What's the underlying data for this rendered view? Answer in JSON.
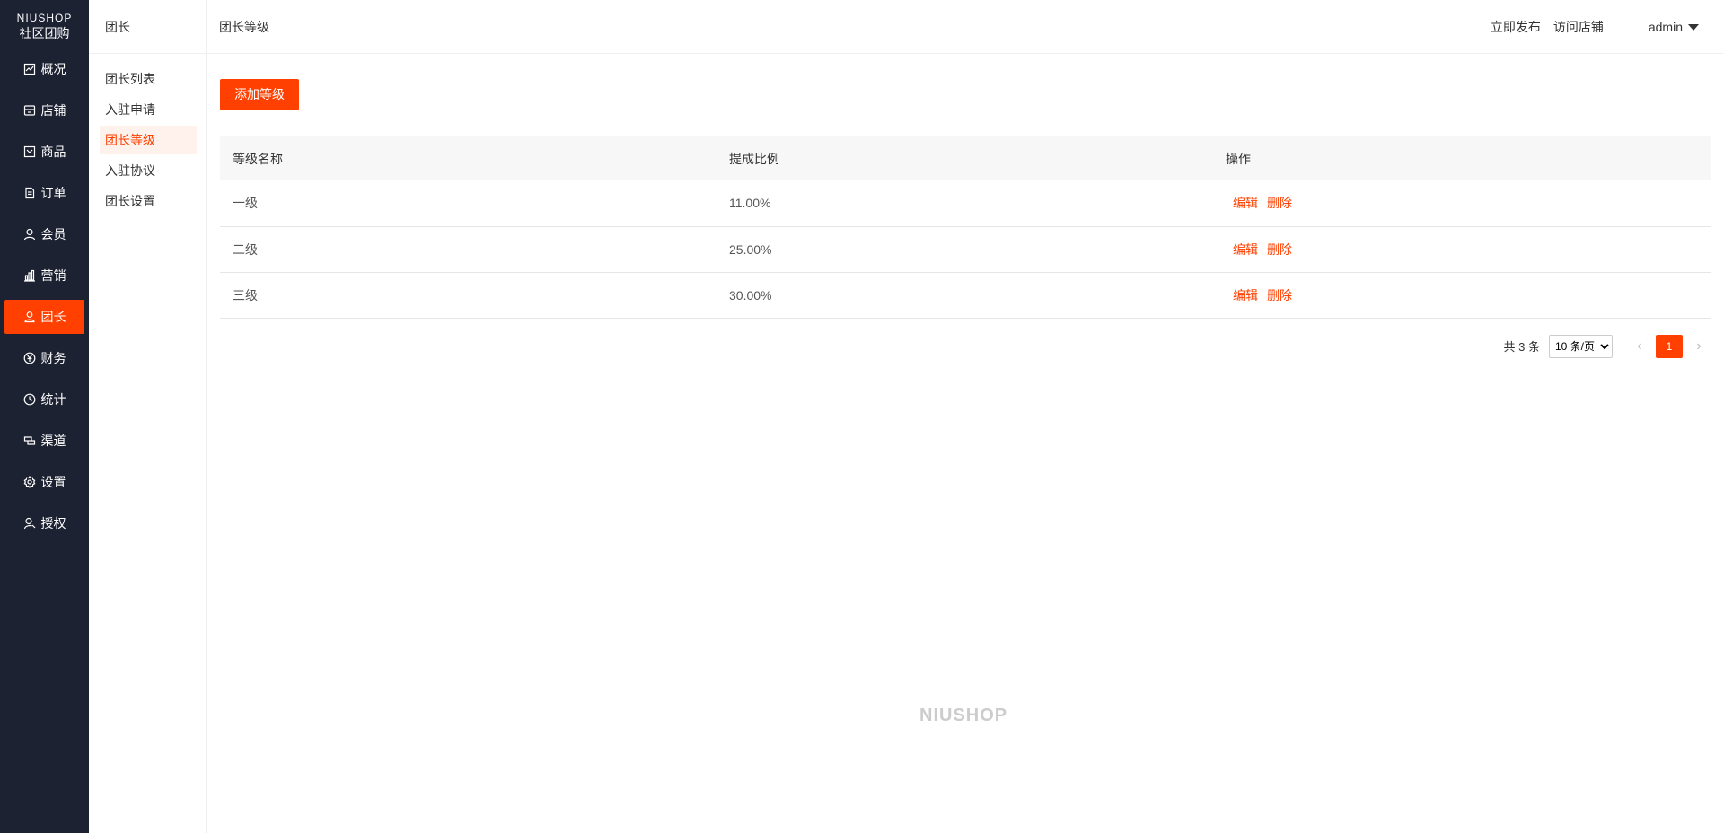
{
  "nav": {
    "brand": "NIUSHOP",
    "subtitle": "社区团购",
    "items": [
      {
        "label": "概况",
        "icon": "chart-line-icon"
      },
      {
        "label": "店铺",
        "icon": "shop-icon"
      },
      {
        "label": "商品",
        "icon": "goods-icon"
      },
      {
        "label": "订单",
        "icon": "order-icon"
      },
      {
        "label": "会员",
        "icon": "user-icon"
      },
      {
        "label": "营销",
        "icon": "bar-chart-icon"
      },
      {
        "label": "团长",
        "icon": "person-icon"
      },
      {
        "label": "财务",
        "icon": "yen-icon"
      },
      {
        "label": "统计",
        "icon": "clock-icon"
      },
      {
        "label": "渠道",
        "icon": "channel-icon"
      },
      {
        "label": "设置",
        "icon": "gear-icon"
      },
      {
        "label": "授权",
        "icon": "key-user-icon"
      }
    ],
    "active_index": 6,
    "active_color": "#ff4000",
    "background": "#1d2233"
  },
  "submenu": {
    "title": "团长",
    "items": [
      "团长列表",
      "入驻申请",
      "团长等级",
      "入驻协议",
      "团长设置"
    ],
    "active_index": 2
  },
  "header": {
    "breadcrumb": "团长等级",
    "publish": "立即发布",
    "visit_store": "访问店铺",
    "user": "admin"
  },
  "toolbar": {
    "add_label": "添加等级"
  },
  "table": {
    "columns": [
      "等级名称",
      "提成比例",
      "操作"
    ],
    "rows": [
      {
        "name": "一级",
        "ratio": "11.00%"
      },
      {
        "name": "二级",
        "ratio": "25.00%"
      },
      {
        "name": "三级",
        "ratio": "30.00%"
      }
    ],
    "edit_label": "编辑",
    "delete_label": "删除"
  },
  "pagination": {
    "total": "共 3 条",
    "page_size": "10 条/页",
    "current_page": "1"
  },
  "footer": {
    "brand": "NIUSHOP"
  }
}
